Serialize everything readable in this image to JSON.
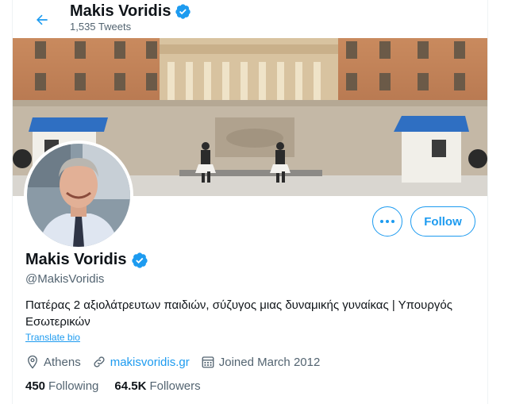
{
  "header": {
    "name": "Makis Voridis",
    "tweets": "1,535 Tweets"
  },
  "profile": {
    "name": "Makis Voridis",
    "handle": "@MakisVoridis",
    "bio": "Πατέρας 2 αξιολάτρευτων παιδιών, σύζυγος μιας δυναμικής γυναίκας | Υπουργός Εσωτερικών",
    "translate_label": "Translate bio",
    "location": "Athens",
    "website": "makisvoridis.gr",
    "joined": "Joined March 2012",
    "following_count": "450",
    "following_label": "Following",
    "followers_count": "64.5K",
    "followers_label": "Followers"
  },
  "actions": {
    "follow_label": "Follow",
    "more_icon": "more-dots-icon"
  },
  "colors": {
    "accent": "#1d9bf0",
    "text_primary": "#0f1419",
    "text_secondary": "#536471"
  }
}
